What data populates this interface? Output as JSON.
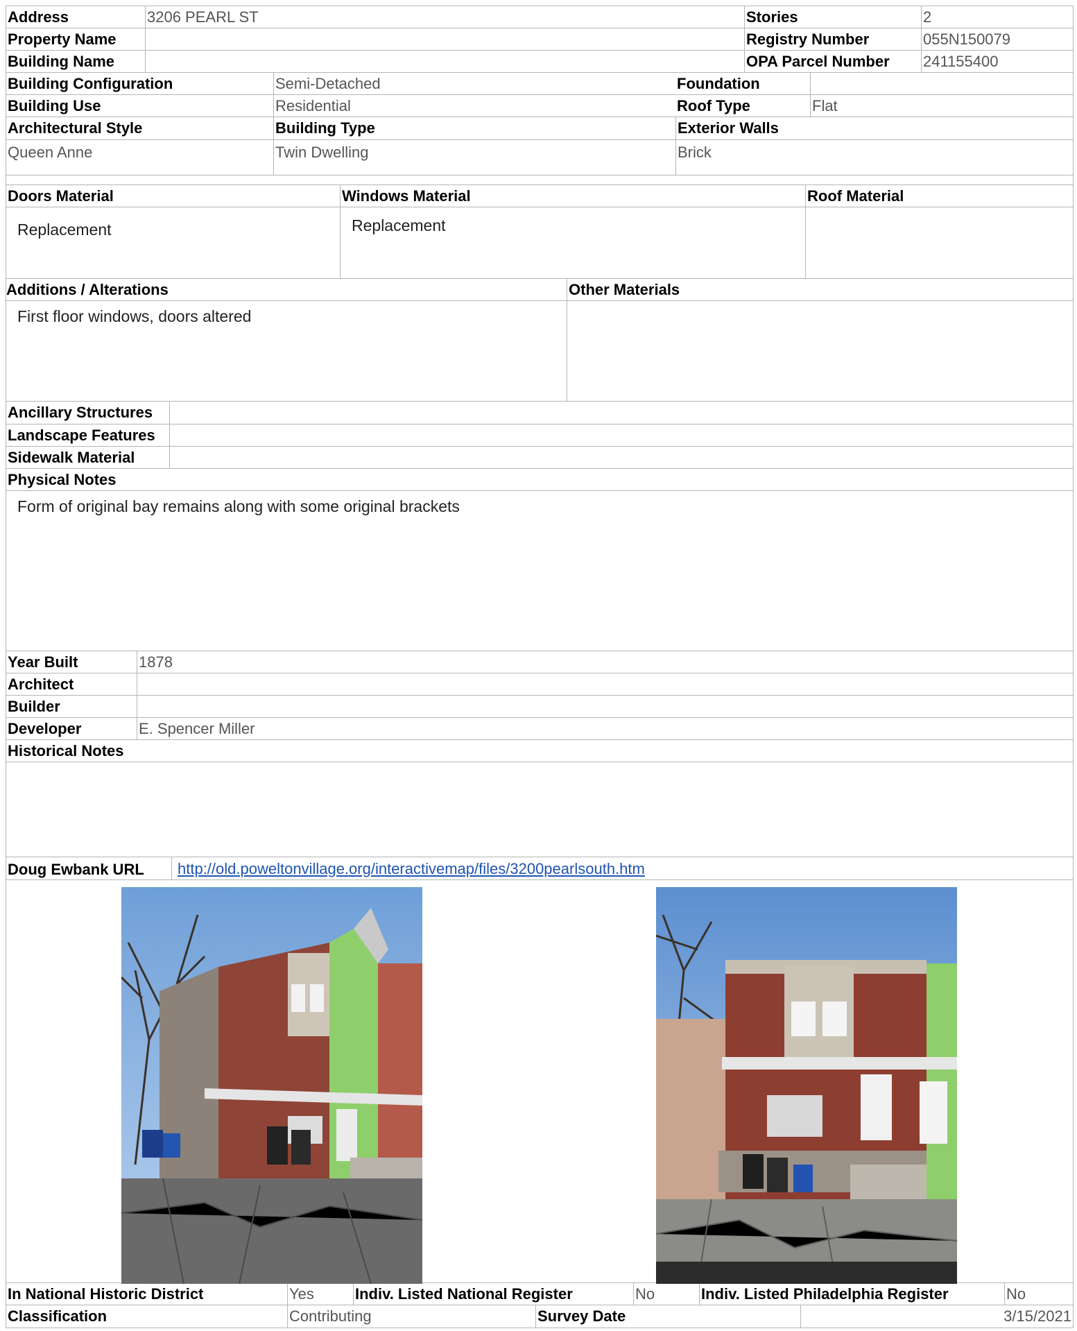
{
  "header": {
    "address_label": "Address",
    "address_value": "3206 PEARL ST",
    "property_name_label": "Property Name",
    "property_name_value": "",
    "building_name_label": "Building Name",
    "building_name_value": "",
    "stories_label": "Stories",
    "stories_value": "2",
    "registry_label": "Registry Number",
    "registry_value": "055N150079",
    "opa_label": "OPA Parcel Number",
    "opa_value": "241155400"
  },
  "building": {
    "config_label": "Building Configuration",
    "config_value": "Semi-Detached",
    "foundation_label": "Foundation",
    "foundation_value": "",
    "use_label": "Building Use",
    "use_value": "Residential",
    "roof_type_label": "Roof Type",
    "roof_type_value": "Flat",
    "style_label": "Architectural Style",
    "style_value": "Queen Anne",
    "type_label": "Building Type",
    "type_value": "Twin Dwelling",
    "walls_label": "Exterior Walls",
    "walls_value": "Brick"
  },
  "materials": {
    "doors_label": "Doors Material",
    "doors_value": "Replacement",
    "windows_label": "Windows Material",
    "windows_value": "Replacement",
    "roof_label": "Roof Material",
    "roof_value": ""
  },
  "alterations": {
    "additions_label": "Additions / Alterations",
    "additions_value": "First floor windows, doors altered",
    "other_label": "Other Materials",
    "other_value": ""
  },
  "site": {
    "ancillary_label": "Ancillary Structures",
    "landscape_label": "Landscape Features",
    "sidewalk_label": "Sidewalk Material",
    "physical_notes_label": "Physical Notes",
    "physical_notes_value": "Form of original bay remains along with some original brackets"
  },
  "history": {
    "year_label": "Year Built",
    "year_value": "1878",
    "architect_label": "Architect",
    "architect_value": "",
    "builder_label": "Builder",
    "builder_value": "",
    "developer_label": "Developer",
    "developer_value": "E. Spencer Miller",
    "notes_label": "Historical Notes",
    "notes_value": ""
  },
  "links": {
    "ewbank_label": "Doug Ewbank URL",
    "ewbank_url": "http://old.poweltonvillage.org/interactivemap/files/3200pearlsouth.htm"
  },
  "footer": {
    "nhd_label": "In National Historic District",
    "nhd_value": "Yes",
    "national_register_label": "Indiv. Listed National Register",
    "national_register_value": "No",
    "phila_register_label": "Indiv. Listed Philadelphia Register",
    "phila_register_value": "No",
    "classification_label": "Classification",
    "classification_value": "Contributing",
    "survey_date_label": "Survey Date",
    "survey_date_value": "3/15/2021"
  }
}
